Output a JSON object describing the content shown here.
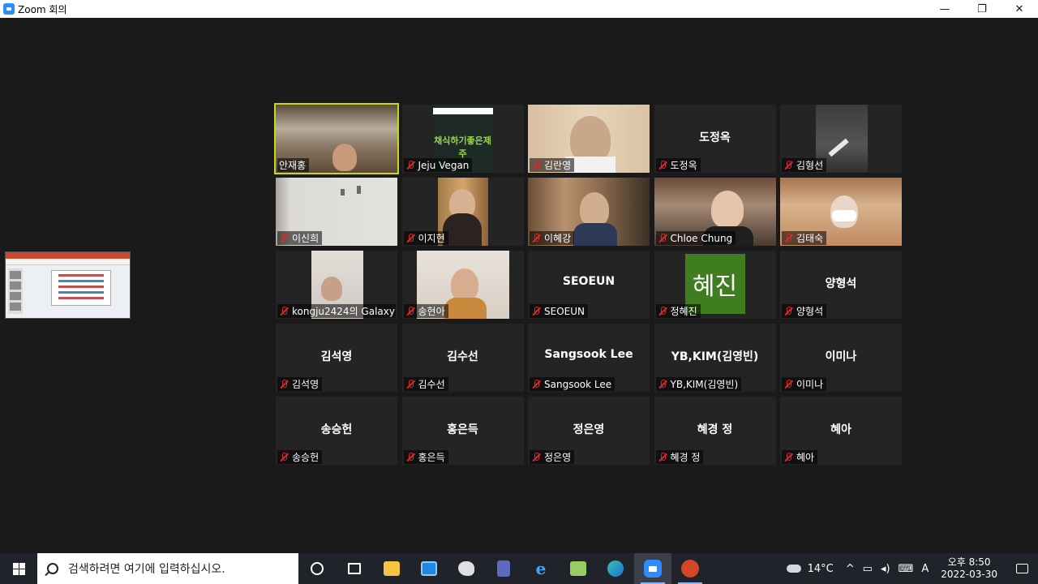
{
  "window": {
    "title": "Zoom 회의",
    "minimize": "—",
    "restore": "❐",
    "close": "✕"
  },
  "participants": [
    {
      "name": "안재홍",
      "display": "",
      "video": true,
      "muted": false,
      "active": true
    },
    {
      "name": "Jeju Vegan",
      "display": "",
      "video": true,
      "muted": true,
      "active": false,
      "poster_text": "채식하기좋은제주"
    },
    {
      "name": "김란영",
      "display": "",
      "video": true,
      "muted": true,
      "active": false
    },
    {
      "name": "도정옥",
      "display": "도정옥",
      "video": false,
      "muted": true,
      "active": false
    },
    {
      "name": "김형선",
      "display": "",
      "video": true,
      "muted": true,
      "active": false
    },
    {
      "name": "이신희",
      "display": "",
      "video": true,
      "muted": true,
      "active": false
    },
    {
      "name": "이지현",
      "display": "",
      "video": true,
      "muted": true,
      "active": false
    },
    {
      "name": "이혜강",
      "display": "",
      "video": true,
      "muted": true,
      "active": false
    },
    {
      "name": "Chloe Chung",
      "display": "",
      "video": true,
      "muted": true,
      "active": false
    },
    {
      "name": "김태숙",
      "display": "",
      "video": true,
      "muted": true,
      "active": false
    },
    {
      "name": "kongju2424의 Galaxy ...",
      "display": "",
      "video": true,
      "muted": true,
      "active": false
    },
    {
      "name": "송현아",
      "display": "",
      "video": true,
      "muted": true,
      "active": false
    },
    {
      "name": "SEOEUN",
      "display": "SEOEUN",
      "video": false,
      "muted": true,
      "active": false
    },
    {
      "name": "정혜진",
      "display": "",
      "video": false,
      "muted": true,
      "active": false,
      "avatar": "혜진"
    },
    {
      "name": "양형석",
      "display": "양형석",
      "video": false,
      "muted": true,
      "active": false
    },
    {
      "name": "김석영",
      "display": "김석영",
      "video": false,
      "muted": true,
      "active": false
    },
    {
      "name": "김수선",
      "display": "김수선",
      "video": false,
      "muted": true,
      "active": false
    },
    {
      "name": "Sangsook Lee",
      "display": "Sangsook Lee",
      "video": false,
      "muted": true,
      "active": false
    },
    {
      "name": "YB,KIM(김영빈)",
      "display": "YB,KIM(김영빈)",
      "video": false,
      "muted": true,
      "active": false
    },
    {
      "name": "이미나",
      "display": "이미나",
      "video": false,
      "muted": true,
      "active": false
    },
    {
      "name": "송승헌",
      "display": "송승헌",
      "video": false,
      "muted": true,
      "active": false
    },
    {
      "name": "홍은득",
      "display": "홍은득",
      "video": false,
      "muted": true,
      "active": false
    },
    {
      "name": "정은영",
      "display": "정은영",
      "video": false,
      "muted": true,
      "active": false
    },
    {
      "name": "혜경 정",
      "display": "혜경 정",
      "video": false,
      "muted": true,
      "active": false
    },
    {
      "name": "혜아",
      "display": "혜아",
      "video": false,
      "muted": true,
      "active": false
    }
  ],
  "taskbar": {
    "search_placeholder": "검색하려면 여기에 입력하십시오.",
    "weather_temp": "14°C",
    "ime": "A",
    "time": "오후 8:50",
    "date": "2022-03-30"
  },
  "colors": {
    "active_speaker": "#c6d81a",
    "muted_icon": "#e02828",
    "avatar_bg": "#3f7d20",
    "zoom_blue": "#2d8cff"
  }
}
